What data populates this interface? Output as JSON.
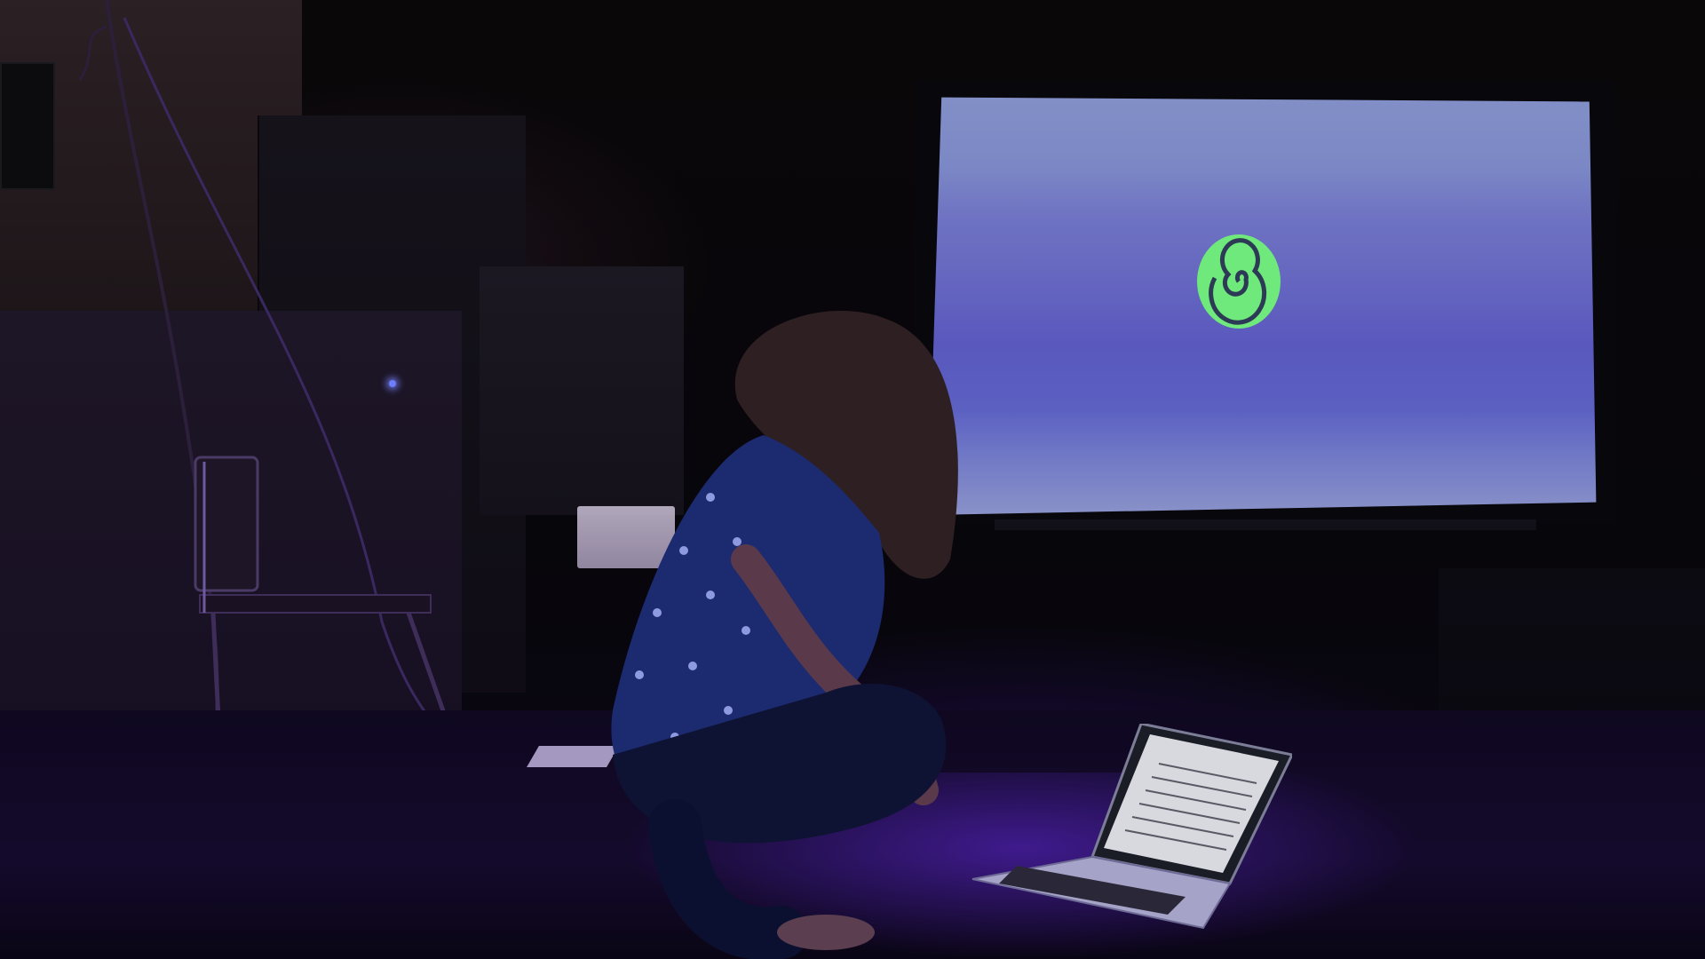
{
  "scene": {
    "projection": {
      "spiral_color": "#7ef08a",
      "screen_top_color": "#8390c7",
      "screen_mid_color": "#5a58bd"
    },
    "lighting": {
      "stage_wash_color": "#5a28d8",
      "led_color": "#6f7dff"
    },
    "icons": [
      "spiral-icon"
    ]
  }
}
